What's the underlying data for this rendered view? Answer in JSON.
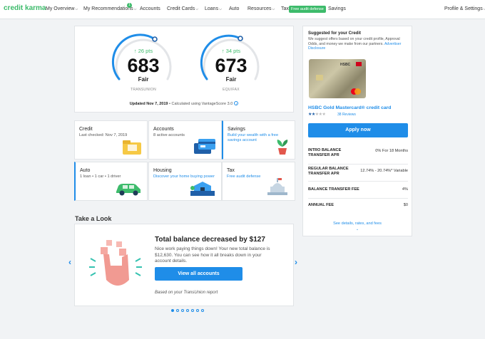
{
  "nav": {
    "logo": "credit karma",
    "items": [
      "My Overview",
      "My Recommendations",
      "Accounts",
      "Credit Cards",
      "Loans",
      "Auto",
      "Resources",
      "Tax",
      "Savings"
    ],
    "notif_count": "1",
    "free_badge": "Free audit defense",
    "profile": "Profile & Settings"
  },
  "scores": [
    {
      "delta": "↑ 26 pts",
      "score": "683",
      "rating": "Fair",
      "bureau": "TRANSUNION",
      "value": 683
    },
    {
      "delta": "↑ 34 pts",
      "score": "673",
      "rating": "Fair",
      "bureau": "EQUIFAX",
      "value": 673
    }
  ],
  "updated": {
    "date": "Updated Nov 7, 2019",
    "rest": " • Calculated using VantageScore 3.0"
  },
  "tiles": [
    {
      "title": "Credit",
      "sub": "Last checked: Nov 7, 2019"
    },
    {
      "title": "Accounts",
      "sub": "8 active accounts"
    },
    {
      "title": "Savings",
      "sub": "Build your wealth with a free savings account"
    },
    {
      "title": "Auto",
      "sub": "1 loan • 1 car • 1 driver"
    },
    {
      "title": "Housing",
      "sub": "Discover your home buying power"
    },
    {
      "title": "Tax",
      "sub": "Free audit defense"
    }
  ],
  "take_look": "Take a Look",
  "promo": {
    "title": "Total balance decreased by $127",
    "body": "Nice work paying things down! Your new total balance is $12,630. You can see how it all breaks down in your account details.",
    "button": "View all accounts",
    "note": "Based on your TransUnion report"
  },
  "side": {
    "heading": "Suggested for your Credit",
    "desc": "We suggest offers based on your credit profile, Approval Odds, and money we make from our partners. ",
    "disclosure": "Advertiser Disclosure",
    "card_brand": "HSBC",
    "card_name": "HSBC Gold Mastercard® credit card",
    "reviews": "38 Reviews",
    "rating": 2,
    "apply": "Apply now",
    "rows": [
      {
        "label": "INTRO BALANCE TRANSFER APR",
        "value": "0%  For 18 Months"
      },
      {
        "label": "REGULAR BALANCE TRANSFER APR",
        "value": "12.74% - 20.74%*  Variable"
      },
      {
        "label": "BALANCE TRANSFER FEE",
        "value": "4%"
      },
      {
        "label": "ANNUAL FEE",
        "value": "$0"
      }
    ],
    "see_more": "See details, rates, and fees"
  },
  "colors": {
    "accent": "#1f8de8",
    "brand": "#3dbb6b"
  }
}
